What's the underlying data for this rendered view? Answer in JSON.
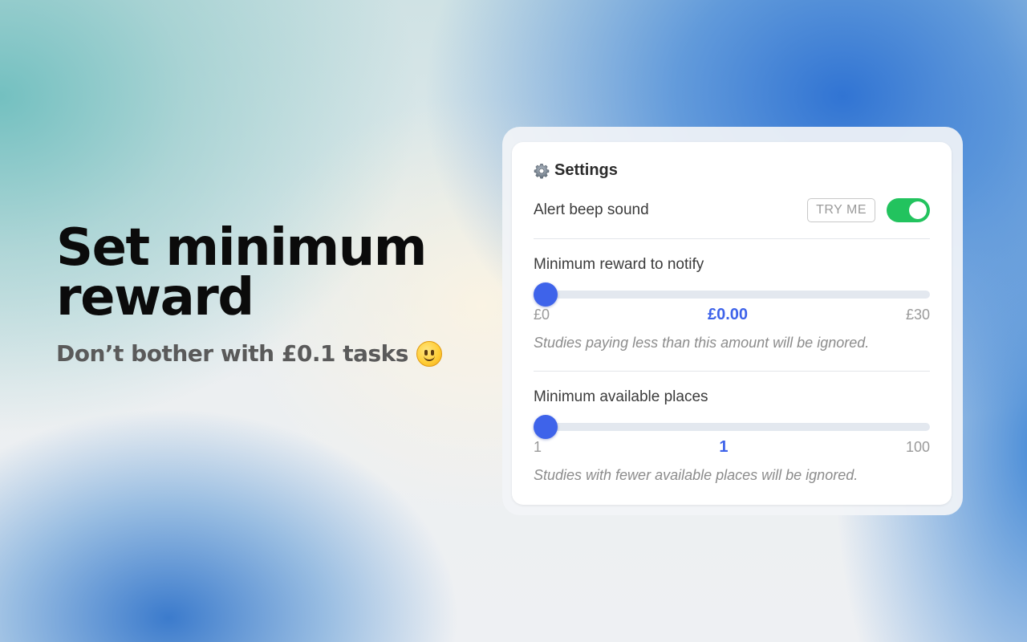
{
  "hero": {
    "title_line1": "Set minimum",
    "title_line2": "reward",
    "subtitle": "Don’t bother with £0.1 tasks",
    "subtitle_emoji": "slightly-smiling-face-icon"
  },
  "settings": {
    "title": "Settings",
    "title_icon": "gear-icon",
    "alert": {
      "label": "Alert beep sound",
      "try_button": "TRY ME",
      "toggle_on": true,
      "toggle_color": "#22c35e"
    },
    "reward": {
      "label": "Minimum reward to notify",
      "min_label": "£0",
      "max_label": "£30",
      "value_label": "£0.00",
      "value": 0,
      "min": 0,
      "max": 30,
      "help": "Studies paying less than this amount will be ignored."
    },
    "places": {
      "label": "Minimum available places",
      "min_label": "1",
      "max_label": "100",
      "value_label": "1",
      "value": 1,
      "min": 1,
      "max": 100,
      "help": "Studies with fewer available places will be ignored."
    },
    "accent_color": "#3e63ea"
  }
}
